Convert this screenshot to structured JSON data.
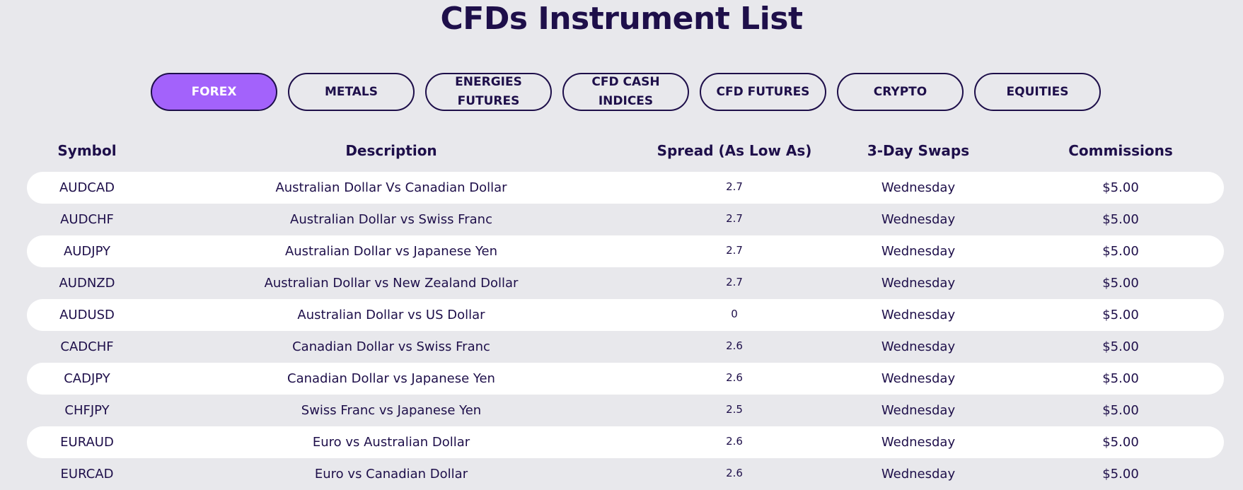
{
  "page": {
    "title": "CFDs Instrument List"
  },
  "tabs": [
    {
      "label": "FOREX",
      "active": true
    },
    {
      "label": "METALS",
      "active": false
    },
    {
      "label": "ENERGIES\nFUTURES",
      "active": false
    },
    {
      "label": "CFD CASH\nINDICES",
      "active": false
    },
    {
      "label": "CFD FUTURES",
      "active": false
    },
    {
      "label": "CRYPTO",
      "active": false
    },
    {
      "label": "EQUITIES",
      "active": false
    }
  ],
  "table": {
    "headers": {
      "symbol": "Symbol",
      "description": "Description",
      "spread": "Spread (As Low As)",
      "swaps": "3-Day Swaps",
      "commissions": "Commissions"
    },
    "rows": [
      {
        "symbol": "AUDCAD",
        "description": "Australian Dollar Vs Canadian Dollar",
        "spread": "2.7",
        "swaps": "Wednesday",
        "commissions": "$5.00"
      },
      {
        "symbol": "AUDCHF",
        "description": "Australian Dollar vs Swiss Franc",
        "spread": "2.7",
        "swaps": "Wednesday",
        "commissions": "$5.00"
      },
      {
        "symbol": "AUDJPY",
        "description": "Australian Dollar vs Japanese Yen",
        "spread": "2.7",
        "swaps": "Wednesday",
        "commissions": "$5.00"
      },
      {
        "symbol": "AUDNZD",
        "description": "Australian Dollar vs New Zealand Dollar",
        "spread": "2.7",
        "swaps": "Wednesday",
        "commissions": "$5.00"
      },
      {
        "symbol": "AUDUSD",
        "description": "Australian Dollar vs US Dollar",
        "spread": "0",
        "swaps": "Wednesday",
        "commissions": "$5.00"
      },
      {
        "symbol": "CADCHF",
        "description": "Canadian Dollar vs Swiss Franc",
        "spread": "2.6",
        "swaps": "Wednesday",
        "commissions": "$5.00"
      },
      {
        "symbol": "CADJPY",
        "description": "Canadian Dollar vs Japanese Yen",
        "spread": "2.6",
        "swaps": "Wednesday",
        "commissions": "$5.00"
      },
      {
        "symbol": "CHFJPY",
        "description": "Swiss Franc vs Japanese Yen",
        "spread": "2.5",
        "swaps": "Wednesday",
        "commissions": "$5.00"
      },
      {
        "symbol": "EURAUD",
        "description": "Euro vs Australian Dollar",
        "spread": "2.6",
        "swaps": "Wednesday",
        "commissions": "$5.00"
      },
      {
        "symbol": "EURCAD",
        "description": "Euro vs Canadian Dollar",
        "spread": "2.6",
        "swaps": "Wednesday",
        "commissions": "$5.00"
      }
    ]
  },
  "colors": {
    "background": "#e8e8ec",
    "text": "#1e0f4a",
    "accent": "#a362fb",
    "row_stripe": "#ffffff"
  }
}
